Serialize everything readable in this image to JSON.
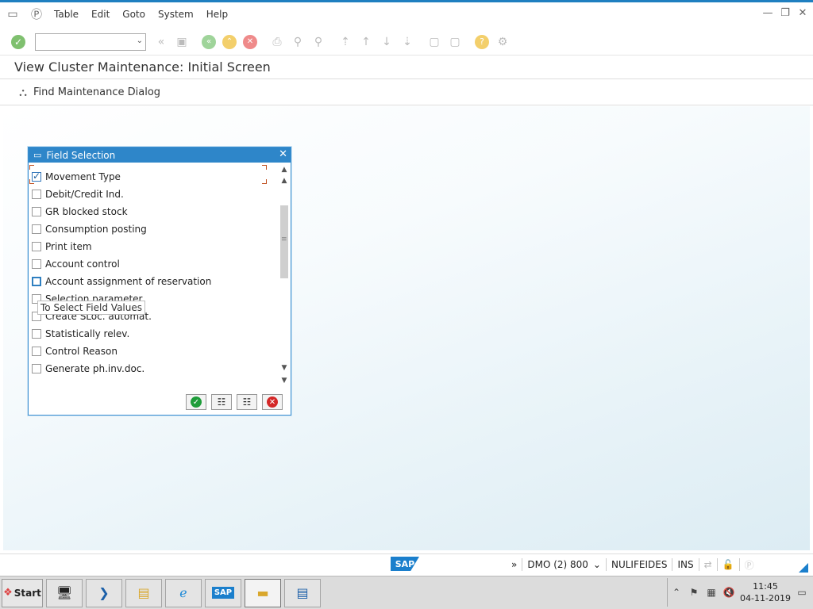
{
  "menubar": {
    "items": [
      "Table",
      "Edit",
      "Goto",
      "System",
      "Help"
    ]
  },
  "toolbar": {
    "command_field_value": ""
  },
  "screen": {
    "title": "View Cluster Maintenance: Initial Screen",
    "app_toolbar_button": "Find Maintenance Dialog"
  },
  "dialog": {
    "title": "Field Selection",
    "rows": [
      {
        "label": "Movement Type",
        "checked": true
      },
      {
        "label": "Debit/Credit Ind.",
        "checked": false
      },
      {
        "label": "GR blocked stock",
        "checked": false
      },
      {
        "label": "Consumption posting",
        "checked": false
      },
      {
        "label": "Print item",
        "checked": false
      },
      {
        "label": "Account control",
        "checked": false
      },
      {
        "label": "Account assignment of reservation",
        "checked": false
      },
      {
        "label": "Selection parameter",
        "checked": false
      },
      {
        "label": "Create SLoc. automat.",
        "checked": false
      },
      {
        "label": "Statistically relev.",
        "checked": false
      },
      {
        "label": "Control Reason",
        "checked": false
      },
      {
        "label": "Generate ph.inv.doc.",
        "checked": false
      }
    ],
    "tooltip": "To Select Field Values"
  },
  "statusbar": {
    "logo": "SAP",
    "system": "DMO (2) 800",
    "user": "NULIFEIDES",
    "mode": "INS"
  },
  "taskbar": {
    "start_label": "Start",
    "clock_time": "11:45",
    "clock_date": "04-11-2019"
  },
  "colors": {
    "accent": "#2e86c9",
    "ok": "#1e9d3a",
    "cancel": "#d42727"
  }
}
